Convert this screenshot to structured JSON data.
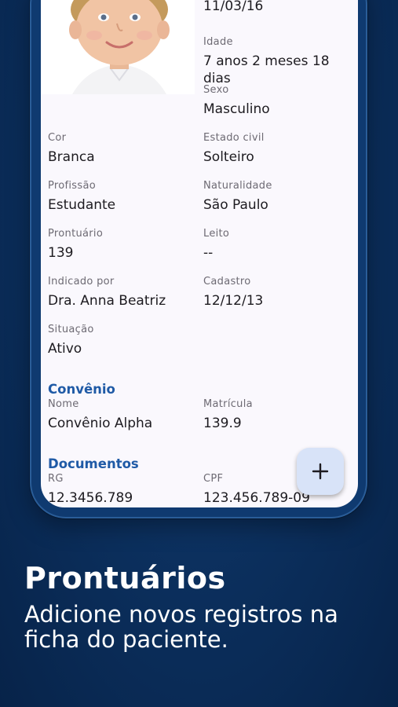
{
  "patient": {
    "birth_date": "11/03/16",
    "fields": {
      "idade": {
        "label": "Idade",
        "value": "7 anos 2 meses 18 dias"
      },
      "sexo": {
        "label": "Sexo",
        "value": "Masculino"
      },
      "cor": {
        "label": "Cor",
        "value": "Branca"
      },
      "estado_civil": {
        "label": "Estado civil",
        "value": "Solteiro"
      },
      "profissao": {
        "label": "Profissão",
        "value": "Estudante"
      },
      "naturalidade": {
        "label": "Naturalidade",
        "value": "São Paulo"
      },
      "prontuario": {
        "label": "Prontuário",
        "value": "139"
      },
      "leito": {
        "label": "Leito",
        "value": "--"
      },
      "indicado_por": {
        "label": "Indicado por",
        "value": "Dra. Anna Beatriz"
      },
      "cadastro": {
        "label": "Cadastro",
        "value": "12/12/13"
      },
      "situacao": {
        "label": "Situação",
        "value": "Ativo"
      }
    }
  },
  "convenio": {
    "title": "Convênio",
    "nome": {
      "label": "Nome",
      "value": "Convênio Alpha"
    },
    "matricula": {
      "label": "Matrícula",
      "value": "139.9"
    }
  },
  "documentos": {
    "title": "Documentos",
    "rg": {
      "label": "RG",
      "value": "12.3456.789"
    },
    "cpf": {
      "label": "CPF",
      "value": "123.456.789-09"
    }
  },
  "fab": {
    "icon": "plus-icon"
  },
  "promo": {
    "headline": "Prontuários",
    "subline": "Adicione novos registros na ficha do paciente."
  },
  "colors": {
    "background": "#0c3160",
    "section_title": "#1f5aa6",
    "fab": "#d8e3f8"
  }
}
